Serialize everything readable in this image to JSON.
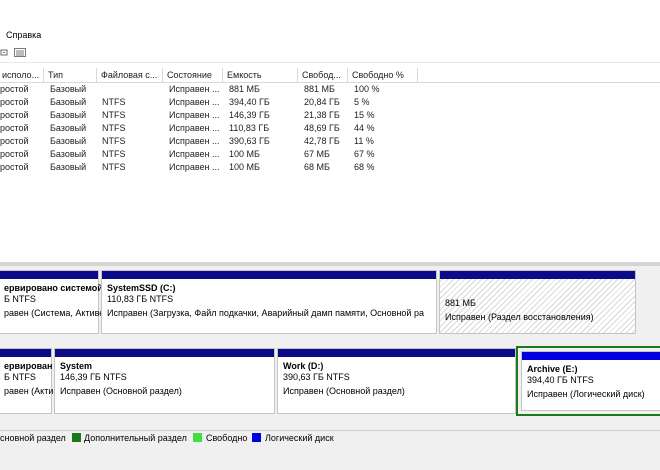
{
  "menu": {
    "help_label": "Справка"
  },
  "list": {
    "columns": [
      "исполо...",
      "Тип",
      "Файловая с...",
      "Состояние",
      "Емкость",
      "Свобод...",
      "Свободно %"
    ],
    "rows": [
      [
        "ростой",
        "Базовый",
        "",
        "Исправен ...",
        "881 МБ",
        "881 МБ",
        "100 %"
      ],
      [
        "ростой",
        "Базовый",
        "NTFS",
        "Исправен ...",
        "394,40 ГБ",
        "20,84 ГБ",
        "5 %"
      ],
      [
        "ростой",
        "Базовый",
        "NTFS",
        "Исправен ...",
        "146,39 ГБ",
        "21,38 ГБ",
        "15 %"
      ],
      [
        "ростой",
        "Базовый",
        "NTFS",
        "Исправен ...",
        "110,83 ГБ",
        "48,69 ГБ",
        "44 %"
      ],
      [
        "ростой",
        "Базовый",
        "NTFS",
        "Исправен ...",
        "390,63 ГБ",
        "42,78 ГБ",
        "11 %"
      ],
      [
        "ростой",
        "Базовый",
        "NTFS",
        "Исправен ...",
        "100 МБ",
        "67 МБ",
        "67 %"
      ],
      [
        "ростой",
        "Базовый",
        "NTFS",
        "Исправен ...",
        "100 МБ",
        "68 МБ",
        "68 %"
      ]
    ]
  },
  "disk0": {
    "reserved": {
      "name": "ервировано системой",
      "size": "Б NTFS",
      "status": "равен (Система, Активен"
    },
    "systemssd": {
      "name": "SystemSSD  (C:)",
      "size": "110,83 ГБ NTFS",
      "status": "Исправен (Загрузка, Файл подкачки, Аварийный дамп памяти, Основной ра"
    },
    "recovery": {
      "size": "881 МБ",
      "status": "Исправен (Раздел восстановления)"
    }
  },
  "disk1": {
    "reserved": {
      "name": "ервирован",
      "size": "Б NTFS",
      "status": "равен (Актив"
    },
    "system": {
      "name": "System",
      "size": "146,39 ГБ NTFS",
      "status": "Исправен (Основной раздел)"
    },
    "work": {
      "name": "Work  (D:)",
      "size": "390,63 ГБ NTFS",
      "status": "Исправен (Основной раздел)"
    },
    "archive": {
      "name": "Archive  (E:)",
      "size": "394,40 ГБ NTFS",
      "status": "Исправен (Логический диск)"
    }
  },
  "legend": {
    "primary": "сновной раздел",
    "extended": "Дополнительный раздел",
    "free": "Свободно",
    "logical": "Логический диск"
  },
  "colors": {
    "primary_bar": "#0b0b8a",
    "logical_bar": "#0000e0",
    "extended": "#1a7a1a",
    "free": "#44dd44",
    "logical": "#0000e0"
  }
}
